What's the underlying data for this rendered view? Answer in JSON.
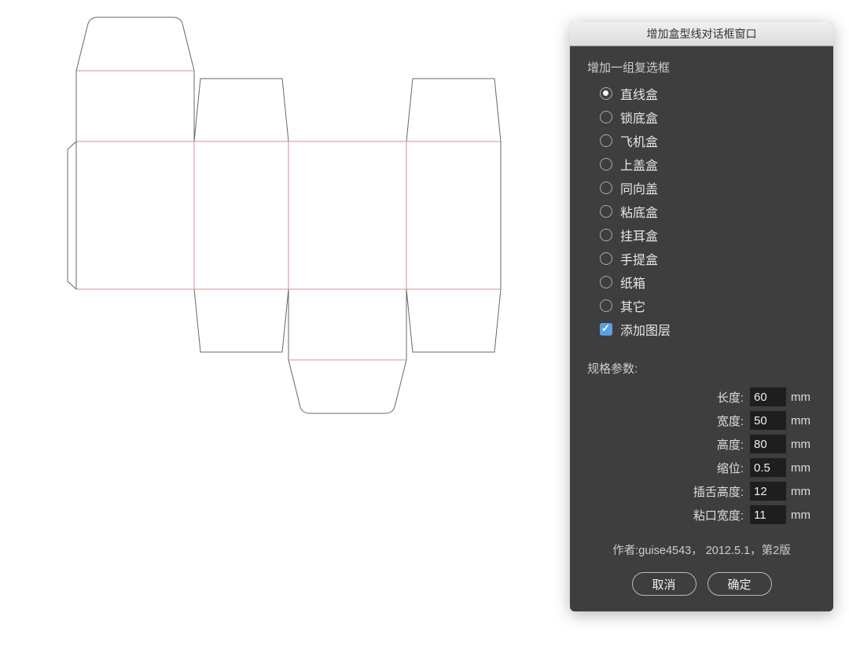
{
  "dialog": {
    "title": "增加盒型线对话框窗口",
    "group_title": "增加一组复选框",
    "options": [
      "直线盒",
      "锁底盒",
      "飞机盒",
      "上盖盒",
      "同向盖",
      "粘底盒",
      "挂耳盒",
      "手提盒",
      "纸箱",
      "其它"
    ],
    "selected_option_index": 0,
    "add_layer_label": "添加图层",
    "add_layer_checked": true,
    "params_title": "规格参数:",
    "params": [
      {
        "label": "长度:",
        "value": "60",
        "unit": "mm"
      },
      {
        "label": "宽度:",
        "value": "50",
        "unit": "mm"
      },
      {
        "label": "高度:",
        "value": "80",
        "unit": "mm"
      },
      {
        "label": "缩位:",
        "value": "0.5",
        "unit": "mm"
      },
      {
        "label": "插舌高度:",
        "value": "12",
        "unit": "mm"
      },
      {
        "label": "粘口宽度:",
        "value": "11",
        "unit": "mm"
      }
    ],
    "author_line": "作者:guise4543，  2012.5.1，第2版",
    "cancel_label": "取消",
    "ok_label": "确定"
  }
}
